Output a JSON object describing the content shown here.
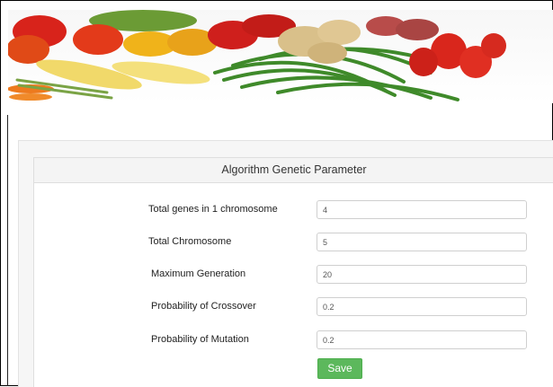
{
  "panel": {
    "title": "Algorithm Genetic Parameter"
  },
  "fields": [
    {
      "label": "Total genes in 1 chromosome",
      "value": "4"
    },
    {
      "label": "Total Chromosome",
      "value": "5"
    },
    {
      "label": "Maximum Generation",
      "value": "20"
    },
    {
      "label": "Probability of Crossover",
      "value": "0.2"
    },
    {
      "label": "Probability of Mutation",
      "value": "0.2"
    }
  ],
  "actions": {
    "save_label": "Save"
  },
  "colors": {
    "save_button": "#5cb85c",
    "heading_bg": "#f4f4f4"
  },
  "banner": {
    "icon": "vegetables-image"
  }
}
